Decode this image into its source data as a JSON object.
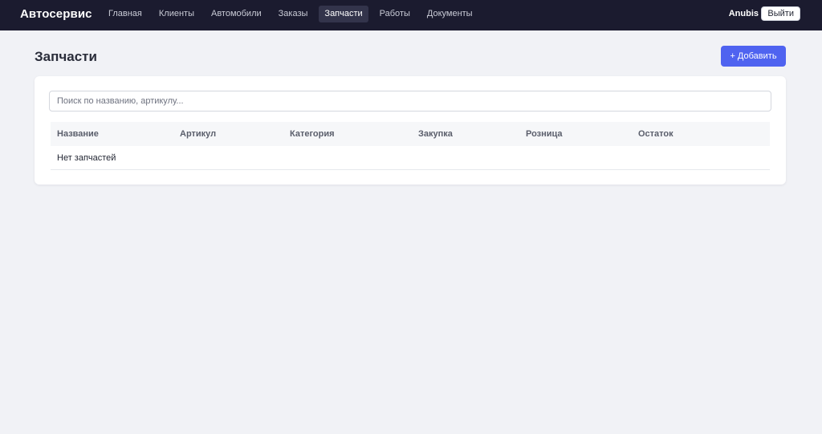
{
  "header": {
    "brand": "Автосервис",
    "nav": [
      {
        "label": "Главная"
      },
      {
        "label": "Клиенты"
      },
      {
        "label": "Автомобили"
      },
      {
        "label": "Заказы"
      },
      {
        "label": "Запчасти",
        "active": true
      },
      {
        "label": "Работы"
      },
      {
        "label": "Документы"
      }
    ],
    "user": "Anubis",
    "logout_label": "Выйти"
  },
  "page": {
    "title": "Запчасти",
    "add_label": "+ Добавить"
  },
  "search": {
    "placeholder": "Поиск по названию, артикулу...",
    "value": ""
  },
  "table": {
    "columns": [
      "Название",
      "Артикул",
      "Категория",
      "Закупка",
      "Розница",
      "Остаток"
    ],
    "empty_text": "Нет запчастей"
  },
  "colors": {
    "topbar": "#1b1b2f",
    "accent": "#4f63f0",
    "background": "#f1f2f6"
  }
}
